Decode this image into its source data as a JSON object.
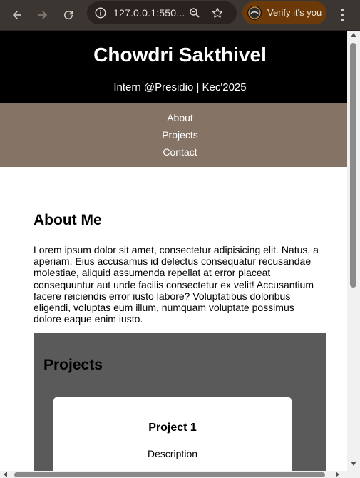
{
  "browser": {
    "url": "127.0.0.1:550...",
    "verify_label": "Verify it's you",
    "icons": [
      "back-icon",
      "forward-icon",
      "reload-icon",
      "info-icon",
      "zoom-icon",
      "star-icon",
      "menu-icon"
    ]
  },
  "header": {
    "title": "Chowdri Sakthivel",
    "subtitle": "Intern @Presidio | Kec'2025"
  },
  "nav": {
    "items": [
      {
        "label": "About"
      },
      {
        "label": "Projects"
      },
      {
        "label": "Contact"
      }
    ]
  },
  "about": {
    "heading": "About Me",
    "text": "Lorem ipsum dolor sit amet, consectetur adipisicing elit. Natus, a aperiam. Eius accusamus id delectus consequatur recusandae molestiae, aliquid assumenda repellat at error placeat consequuntur aut unde facilis consectetur ex velit! Accusantium facere reiciendis error iusto labore? Voluptatibus doloribus eligendi, voluptas eum illum, numquam voluptate possimus dolore eaque enim iusto."
  },
  "projects": {
    "heading": "Projects",
    "cards": [
      {
        "title": "Project 1",
        "description": "Description"
      }
    ]
  },
  "colors": {
    "header_bg": "#000000",
    "nav_bg": "#857365",
    "projects_bg": "#5a5a5a",
    "chrome_bg": "#3c3633",
    "verify_bg": "#6b3a08"
  }
}
